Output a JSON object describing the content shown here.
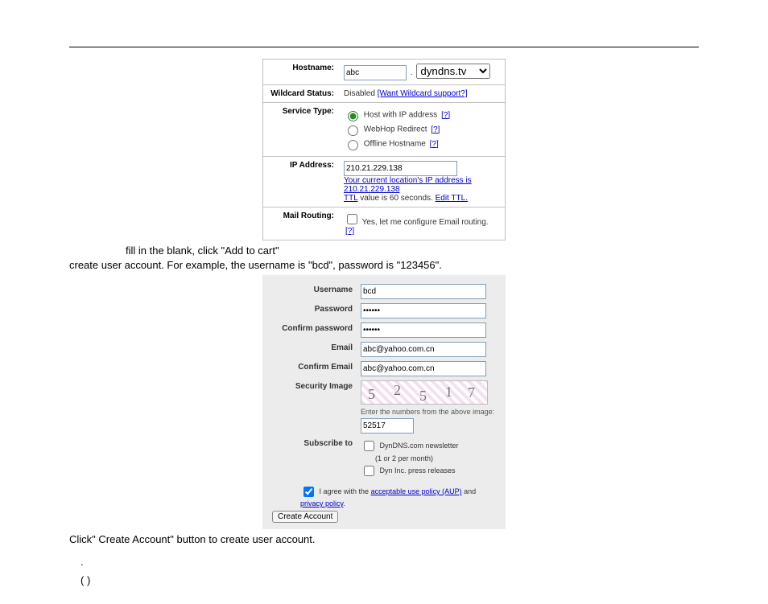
{
  "panel1": {
    "labels": {
      "hostname": "Hostname:",
      "wildcard": "Wildcard Status:",
      "service": "Service Type:",
      "ip": "IP Address:",
      "mail": "Mail Routing:"
    },
    "hostname_value": "abc",
    "hostname_domain": "dyndns.tv",
    "wildcard_disabled": "Disabled",
    "wildcard_link": "[Want Wildcard support?]",
    "service_opts": {
      "host": "Host with IP address",
      "webhop": "WebHop Redirect",
      "offline": "Offline Hostname"
    },
    "help": "[?]",
    "ip_value": "210.21.229.138",
    "ip_hint_prefix": "Your current location's IP address is ",
    "ip_hint_addr": "210.21.229.138",
    "ttl_text1": "TTL",
    "ttl_text2": " value is 60 seconds. ",
    "ttl_edit": "Edit TTL.",
    "mail_text": "Yes, let me configure Email routing."
  },
  "instr": {
    "line1": "fill in the blank, click \"Add to cart\"",
    "line2": "create user account. For example, the username is \"bcd\", password is \"123456\".",
    "line3": "Click\" Create Account\" button to create user account.",
    "dot": ".",
    "paren": "(    )"
  },
  "panel2": {
    "labels": {
      "username": "Username",
      "password": "Password",
      "confirm_pw": "Confirm password",
      "email": "Email",
      "confirm_email": "Confirm Email",
      "security": "Security Image",
      "subscribe": "Subscribe to"
    },
    "username_value": "bcd",
    "password_value": "••••••",
    "confirm_pw_value": "••••••",
    "email_value": "abc@yahoo.com.cn",
    "confirm_email_value": "abc@yahoo.com.cn",
    "captcha_digits": [
      "5",
      "2",
      "5",
      "1",
      "7"
    ],
    "captcha_hint": "Enter the numbers from the above image:",
    "captcha_input": "52517",
    "subscribe_opts": {
      "newsletter": "DynDNS.com newsletter",
      "newsletter_sub": "(1 or 2 per month)",
      "press": "Dyn Inc. press releases"
    },
    "agree_pre": "I agree with the ",
    "agree_aup": "acceptable use policy (AUP)",
    "agree_mid": " and ",
    "agree_privacy": "privacy policy",
    "agree_post": ".",
    "create_btn": "Create Account"
  }
}
